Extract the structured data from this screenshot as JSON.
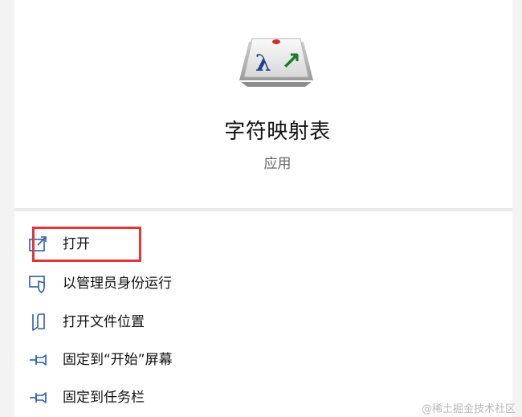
{
  "app": {
    "name": "字符映射表",
    "type": "应用",
    "icon": "character-map-key-icon",
    "icon_glyphs": {
      "left": "λ",
      "right": "↗"
    }
  },
  "menu": {
    "items": [
      {
        "label": "打开",
        "icon": "open-icon",
        "highlighted": true
      },
      {
        "label": "以管理员身份运行",
        "icon": "shield-icon",
        "highlighted": false
      },
      {
        "label": "打开文件位置",
        "icon": "folder-location-icon",
        "highlighted": false
      },
      {
        "label": "固定到“开始”屏幕",
        "icon": "pin-start-icon",
        "highlighted": false
      },
      {
        "label": "固定到任务栏",
        "icon": "pin-taskbar-icon",
        "highlighted": false
      }
    ]
  },
  "watermark": "@稀土掘金技术社区",
  "colors": {
    "accent_icon": "#2b5ea8",
    "highlight_border": "#e0353b",
    "text": "#111111",
    "subtext": "#666666"
  }
}
